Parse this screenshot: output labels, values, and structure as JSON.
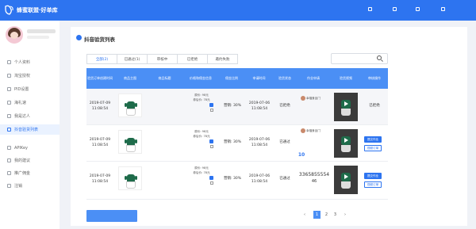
{
  "header": {
    "brand": "蜂蜜联盟·好单库",
    "brand_sub": "",
    "nav": [
      {
        "label": "",
        "icon": "notification-icon"
      },
      {
        "label": "",
        "icon": "user-icon"
      },
      {
        "label": "",
        "icon": "link-icon"
      },
      {
        "label": "",
        "icon": "logout-icon"
      }
    ]
  },
  "sidebar": {
    "items": [
      {
        "label": "个人资料",
        "icon": "user-icon",
        "active": false
      },
      {
        "label": "淘宝授权",
        "icon": "taobao-icon",
        "active": false
      },
      {
        "label": "PID设置",
        "icon": "settings-icon",
        "active": false
      },
      {
        "label": "海礼速",
        "icon": "gift-icon",
        "active": false
      },
      {
        "label": "我是达人",
        "icon": "star-icon",
        "active": false
      },
      {
        "label": "抖音验货列表",
        "icon": "list-icon",
        "active": true
      },
      {
        "label": "APIKey",
        "icon": "key-icon",
        "active": false
      },
      {
        "label": "我的建议",
        "icon": "feedback-icon",
        "active": false
      },
      {
        "label": "推广佣金",
        "icon": "money-icon",
        "active": false
      },
      {
        "label": "注销",
        "icon": "logout-icon",
        "active": false
      }
    ]
  },
  "page": {
    "title": "抖音验货列表",
    "subtitle": "",
    "note": "",
    "tabs": [
      {
        "label": "全部(2)",
        "active": true
      },
      {
        "label": "已通过(1)",
        "active": false
      },
      {
        "label": "审核中",
        "active": false
      },
      {
        "label": "已拒绝",
        "active": false
      },
      {
        "label": "邀约失败",
        "active": false
      }
    ],
    "search_placeholder": ""
  },
  "table": {
    "headers": [
      "验货订单创建时间",
      "商品主图",
      "商品标题",
      "价格和佣金信息",
      "佣金比例",
      "申请时间",
      "验货状态",
      "作业申请",
      "验货视频",
      "审核操作"
    ],
    "rows": [
      {
        "created": "2019-07-09 11:08:54",
        "title": "",
        "price": "原价: 98元",
        "coupon": "券后价: 78元",
        "stock": "",
        "commission": "营销: 30%",
        "apply_time": "2019-07-06 11:08:54",
        "status": "已拒绝",
        "shop": "幸福食品门",
        "shop_id": "",
        "link": "",
        "action_text": "已拒绝",
        "actions": []
      },
      {
        "created": "2019-07-09 11:08:54",
        "title": "",
        "price": "原价: 98元",
        "coupon": "券后价: 78元",
        "stock": "",
        "commission": "营销: 30%",
        "apply_time": "2019-07-06 11:08:54",
        "status": "已通过",
        "shop": "幸福食品门",
        "shop_id": "",
        "link": "",
        "extra_main": "10",
        "extra_sub": "",
        "actions": [
          "提交作业",
          "视频订单"
        ]
      },
      {
        "created": "2019-07-09 11:08:54",
        "title": "",
        "price": "原价: 98元",
        "coupon": "券后价: 78元",
        "stock": "",
        "commission": "营销: 30%",
        "apply_time": "2019-07-06 11:08:54",
        "status": "已通过",
        "account_main": "3365855554",
        "account_sub": "46",
        "actions": [
          "提交作业",
          "视频订单"
        ]
      }
    ]
  },
  "footer": {
    "more_button": "",
    "pager": [
      "‹",
      "1",
      "2",
      "3",
      "›"
    ],
    "pager_current": "1"
  },
  "colors": {
    "primary": "#2d74f0",
    "table_header": "#4b8ff5"
  }
}
